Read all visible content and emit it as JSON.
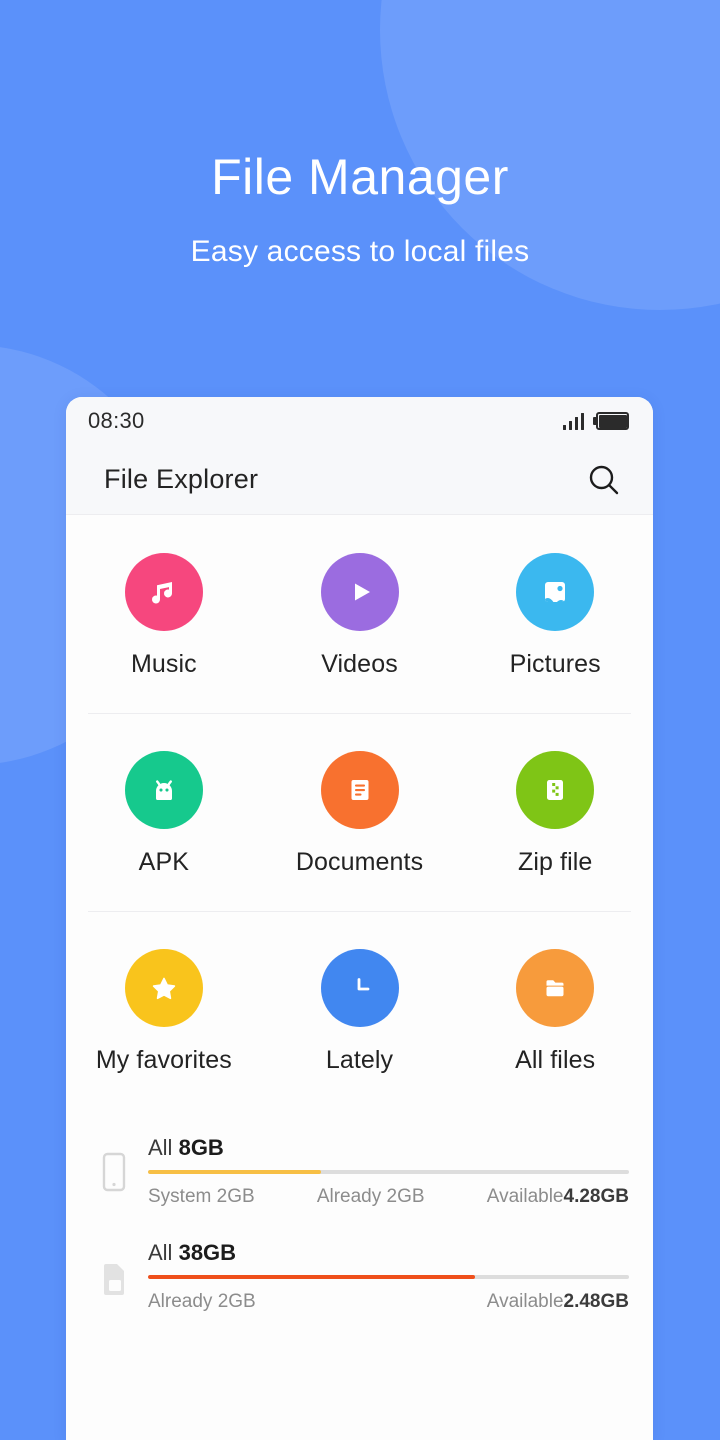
{
  "hero": {
    "title": "File Manager",
    "subtitle": "Easy access to local files",
    "bg_color": "#5b91fa",
    "blob_color": "#6d9dfb"
  },
  "phone": {
    "statusbar": {
      "time": "08:30",
      "signal_icon": "signal-bars-icon",
      "battery_icon": "battery-full-icon"
    },
    "appbar": {
      "title": "File Explorer",
      "search_icon": "search-icon"
    },
    "categories": [
      {
        "label": "Music",
        "icon": "music-note-icon",
        "color": "#f6477e"
      },
      {
        "label": "Videos",
        "icon": "play-icon",
        "color": "#9b6ce0"
      },
      {
        "label": "Pictures",
        "icon": "picture-icon",
        "color": "#3bb8ef"
      },
      {
        "label": "APK",
        "icon": "android-icon",
        "color": "#16c98d"
      },
      {
        "label": "Documents",
        "icon": "document-icon",
        "color": "#f8712f"
      },
      {
        "label": "Zip file",
        "icon": "zip-file-icon",
        "color": "#7fc516"
      },
      {
        "label": "My favorites",
        "icon": "star-icon",
        "color": "#f9c41c"
      },
      {
        "label": "Lately",
        "icon": "clock-icon",
        "color": "#4187f0"
      },
      {
        "label": "All files",
        "icon": "folder-icon",
        "color": "#f79b3c"
      }
    ],
    "storage": [
      {
        "device_icon": "phone-icon",
        "title_prefix": "All",
        "total": "8GB",
        "bar_percent": 36,
        "bar_color": "#f7bf45",
        "legend": [
          {
            "label": "System 2GB",
            "value": ""
          },
          {
            "label": "Already 2GB",
            "value": ""
          },
          {
            "label": "Available",
            "value": "4.28GB"
          }
        ]
      },
      {
        "device_icon": "sdcard-icon",
        "title_prefix": "All",
        "total": "38GB",
        "bar_percent": 68,
        "bar_color": "#ef4f1b",
        "legend": [
          {
            "label": "Already 2GB",
            "value": ""
          },
          {
            "label": "Available",
            "value": "2.48GB"
          }
        ]
      }
    ]
  }
}
